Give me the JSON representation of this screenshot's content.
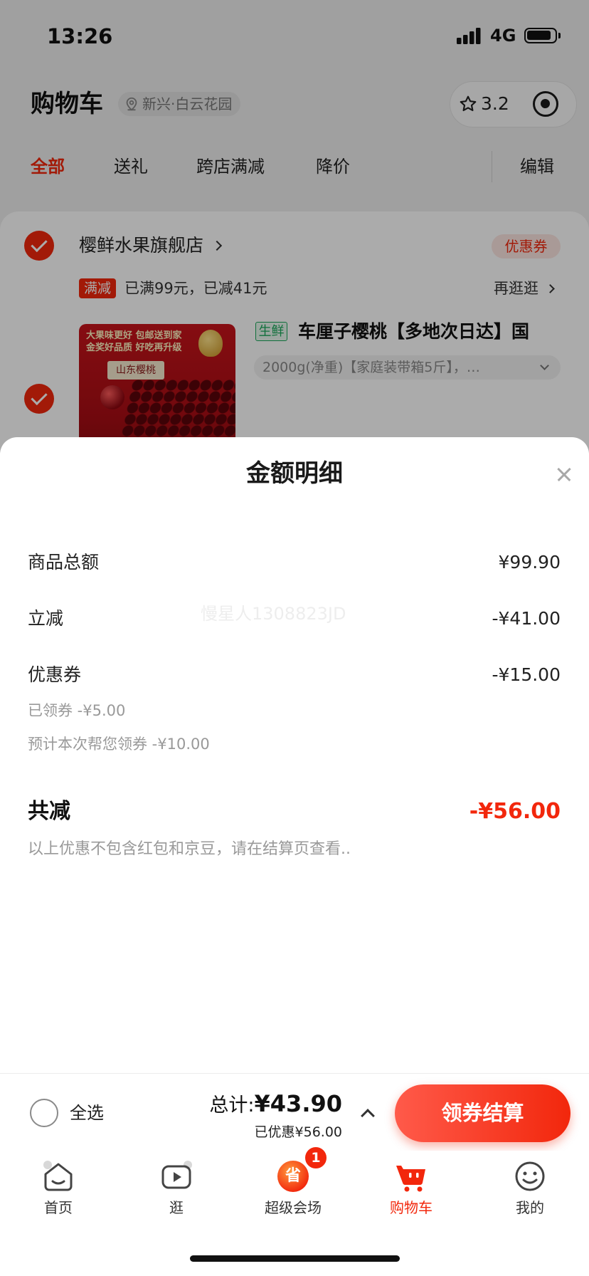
{
  "status_bar": {
    "time": "13:26",
    "network": "4G"
  },
  "header": {
    "title": "购物车",
    "location": "新兴·白云花园",
    "rating": "3.2"
  },
  "tabs": [
    {
      "label": "全部",
      "active": true
    },
    {
      "label": "送礼"
    },
    {
      "label": "跨店满减"
    },
    {
      "label": "降价"
    }
  ],
  "edit_label": "编辑",
  "store": {
    "name": "樱鲜水果旗舰店",
    "checked": true,
    "coupon_label": "优惠券",
    "promo_tag": "满减",
    "promo_text": "已满99元，已减41元",
    "promo_link": "再逛逛"
  },
  "product": {
    "checked": true,
    "tag": "生鲜",
    "title": "车厘子樱桃【多地次日达】国",
    "spec": "2000g(净重)【家庭装带箱5斤】，…",
    "image_text": {
      "line1": "大果味更好 包邮送到家",
      "line2": "金奖好品质 好吃再升级",
      "box_label": "山东樱桃"
    }
  },
  "sheet": {
    "title": "金额明细",
    "rows": [
      {
        "label": "商品总额",
        "value": "¥99.90"
      },
      {
        "label": "立减",
        "value": "-¥41.00"
      },
      {
        "label": "优惠券",
        "value": "-¥15.00"
      }
    ],
    "coupon_details": [
      "已领券 -¥5.00",
      "预计本次帮您领券 -¥10.00"
    ],
    "total": {
      "label": "共减",
      "value": "-¥56.00"
    },
    "note": "以上优惠不包含红包和京豆，请在结算页查看..",
    "watermark": "慢星人1308823JD"
  },
  "bottom_bar": {
    "select_all": "全选",
    "select_all_checked": false,
    "total_label": "总计:",
    "total_value": "¥43.90",
    "discount": "已优惠¥56.00",
    "checkout_label": "领券结算"
  },
  "tab_bar": [
    {
      "label": "首页",
      "icon": "home-icon"
    },
    {
      "label": "逛",
      "icon": "video-icon"
    },
    {
      "label": "超级会场",
      "icon": "super-venue-icon",
      "icon_text": "省",
      "badge": "1"
    },
    {
      "label": "购物车",
      "icon": "cart-icon",
      "active": true
    },
    {
      "label": "我的",
      "icon": "profile-icon"
    }
  ],
  "colors": {
    "accent": "#f2270c",
    "fresh_tag": "#1aa85a",
    "muted_text": "#999999"
  }
}
